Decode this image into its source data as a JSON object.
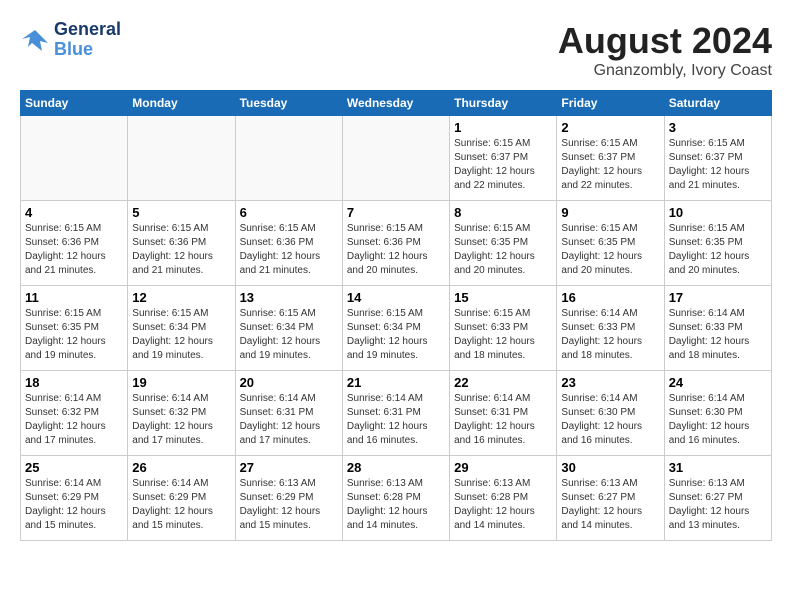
{
  "header": {
    "logo_line1": "General",
    "logo_line2": "Blue",
    "month_title": "August 2024",
    "location": "Gnanzombly, Ivory Coast"
  },
  "weekdays": [
    "Sunday",
    "Monday",
    "Tuesday",
    "Wednesday",
    "Thursday",
    "Friday",
    "Saturday"
  ],
  "weeks": [
    [
      {
        "day": "",
        "empty": true
      },
      {
        "day": "",
        "empty": true
      },
      {
        "day": "",
        "empty": true
      },
      {
        "day": "",
        "empty": true
      },
      {
        "day": "1",
        "sunrise": "6:15 AM",
        "sunset": "6:37 PM",
        "daylight": "12 hours and 22 minutes."
      },
      {
        "day": "2",
        "sunrise": "6:15 AM",
        "sunset": "6:37 PM",
        "daylight": "12 hours and 22 minutes."
      },
      {
        "day": "3",
        "sunrise": "6:15 AM",
        "sunset": "6:37 PM",
        "daylight": "12 hours and 21 minutes."
      }
    ],
    [
      {
        "day": "4",
        "sunrise": "6:15 AM",
        "sunset": "6:36 PM",
        "daylight": "12 hours and 21 minutes."
      },
      {
        "day": "5",
        "sunrise": "6:15 AM",
        "sunset": "6:36 PM",
        "daylight": "12 hours and 21 minutes."
      },
      {
        "day": "6",
        "sunrise": "6:15 AM",
        "sunset": "6:36 PM",
        "daylight": "12 hours and 21 minutes."
      },
      {
        "day": "7",
        "sunrise": "6:15 AM",
        "sunset": "6:36 PM",
        "daylight": "12 hours and 20 minutes."
      },
      {
        "day": "8",
        "sunrise": "6:15 AM",
        "sunset": "6:35 PM",
        "daylight": "12 hours and 20 minutes."
      },
      {
        "day": "9",
        "sunrise": "6:15 AM",
        "sunset": "6:35 PM",
        "daylight": "12 hours and 20 minutes."
      },
      {
        "day": "10",
        "sunrise": "6:15 AM",
        "sunset": "6:35 PM",
        "daylight": "12 hours and 20 minutes."
      }
    ],
    [
      {
        "day": "11",
        "sunrise": "6:15 AM",
        "sunset": "6:35 PM",
        "daylight": "12 hours and 19 minutes."
      },
      {
        "day": "12",
        "sunrise": "6:15 AM",
        "sunset": "6:34 PM",
        "daylight": "12 hours and 19 minutes."
      },
      {
        "day": "13",
        "sunrise": "6:15 AM",
        "sunset": "6:34 PM",
        "daylight": "12 hours and 19 minutes."
      },
      {
        "day": "14",
        "sunrise": "6:15 AM",
        "sunset": "6:34 PM",
        "daylight": "12 hours and 19 minutes."
      },
      {
        "day": "15",
        "sunrise": "6:15 AM",
        "sunset": "6:33 PM",
        "daylight": "12 hours and 18 minutes."
      },
      {
        "day": "16",
        "sunrise": "6:14 AM",
        "sunset": "6:33 PM",
        "daylight": "12 hours and 18 minutes."
      },
      {
        "day": "17",
        "sunrise": "6:14 AM",
        "sunset": "6:33 PM",
        "daylight": "12 hours and 18 minutes."
      }
    ],
    [
      {
        "day": "18",
        "sunrise": "6:14 AM",
        "sunset": "6:32 PM",
        "daylight": "12 hours and 17 minutes."
      },
      {
        "day": "19",
        "sunrise": "6:14 AM",
        "sunset": "6:32 PM",
        "daylight": "12 hours and 17 minutes."
      },
      {
        "day": "20",
        "sunrise": "6:14 AM",
        "sunset": "6:31 PM",
        "daylight": "12 hours and 17 minutes."
      },
      {
        "day": "21",
        "sunrise": "6:14 AM",
        "sunset": "6:31 PM",
        "daylight": "12 hours and 16 minutes."
      },
      {
        "day": "22",
        "sunrise": "6:14 AM",
        "sunset": "6:31 PM",
        "daylight": "12 hours and 16 minutes."
      },
      {
        "day": "23",
        "sunrise": "6:14 AM",
        "sunset": "6:30 PM",
        "daylight": "12 hours and 16 minutes."
      },
      {
        "day": "24",
        "sunrise": "6:14 AM",
        "sunset": "6:30 PM",
        "daylight": "12 hours and 16 minutes."
      }
    ],
    [
      {
        "day": "25",
        "sunrise": "6:14 AM",
        "sunset": "6:29 PM",
        "daylight": "12 hours and 15 minutes."
      },
      {
        "day": "26",
        "sunrise": "6:14 AM",
        "sunset": "6:29 PM",
        "daylight": "12 hours and 15 minutes."
      },
      {
        "day": "27",
        "sunrise": "6:13 AM",
        "sunset": "6:29 PM",
        "daylight": "12 hours and 15 minutes."
      },
      {
        "day": "28",
        "sunrise": "6:13 AM",
        "sunset": "6:28 PM",
        "daylight": "12 hours and 14 minutes."
      },
      {
        "day": "29",
        "sunrise": "6:13 AM",
        "sunset": "6:28 PM",
        "daylight": "12 hours and 14 minutes."
      },
      {
        "day": "30",
        "sunrise": "6:13 AM",
        "sunset": "6:27 PM",
        "daylight": "12 hours and 14 minutes."
      },
      {
        "day": "31",
        "sunrise": "6:13 AM",
        "sunset": "6:27 PM",
        "daylight": "12 hours and 13 minutes."
      }
    ]
  ]
}
